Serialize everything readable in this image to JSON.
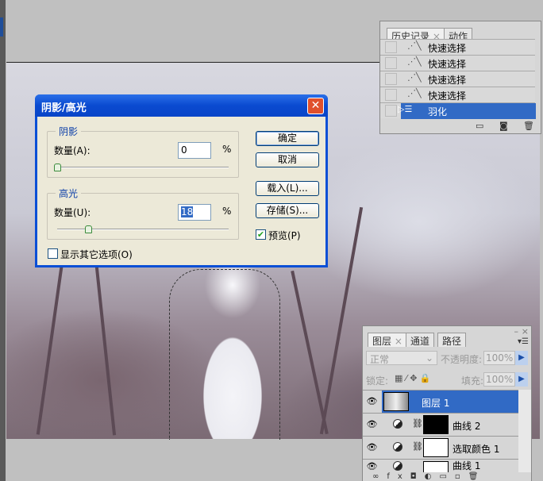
{
  "dialog": {
    "title": "阴影/高光",
    "close": "✕",
    "shadows": {
      "legend": "阴影",
      "amount_label": "数量(A):",
      "value": "0",
      "unit": "%",
      "slider_percent": 0
    },
    "highlights": {
      "legend": "高光",
      "amount_label": "数量(U):",
      "value": "18",
      "unit": "%",
      "slider_percent": 18
    },
    "buttons": {
      "ok": "确定",
      "cancel": "取消",
      "load": "载入(L)...",
      "save": "存储(S)..."
    },
    "preview": {
      "label": "预览(P)",
      "checked": true
    },
    "show_more": {
      "label": "显示其它选项(O)",
      "checked": false
    }
  },
  "history_panel": {
    "tabs": [
      "历史记录",
      "动作"
    ],
    "tab_close": "×",
    "items": [
      {
        "label": "快速选择",
        "icon": "quick-selection-icon"
      },
      {
        "label": "快速选择",
        "icon": "quick-selection-icon"
      },
      {
        "label": "快速选择",
        "icon": "quick-selection-icon"
      },
      {
        "label": "快速选择",
        "icon": "quick-selection-icon"
      },
      {
        "label": "羽化",
        "icon": "feather-icon",
        "selected": true
      }
    ]
  },
  "layers_panel": {
    "tabs": [
      "图层",
      "通道",
      "路径"
    ],
    "tab_close": "×",
    "blend_mode": "正常",
    "opacity_label": "不透明度:",
    "opacity": "100%",
    "lock_label": "锁定:",
    "fill_label": "填充:",
    "fill": "100%",
    "layers": [
      {
        "name": "图层 1",
        "selected": true
      },
      {
        "name": "曲线 2"
      },
      {
        "name": "选取颜色 1"
      },
      {
        "name": "曲线 1"
      }
    ]
  }
}
